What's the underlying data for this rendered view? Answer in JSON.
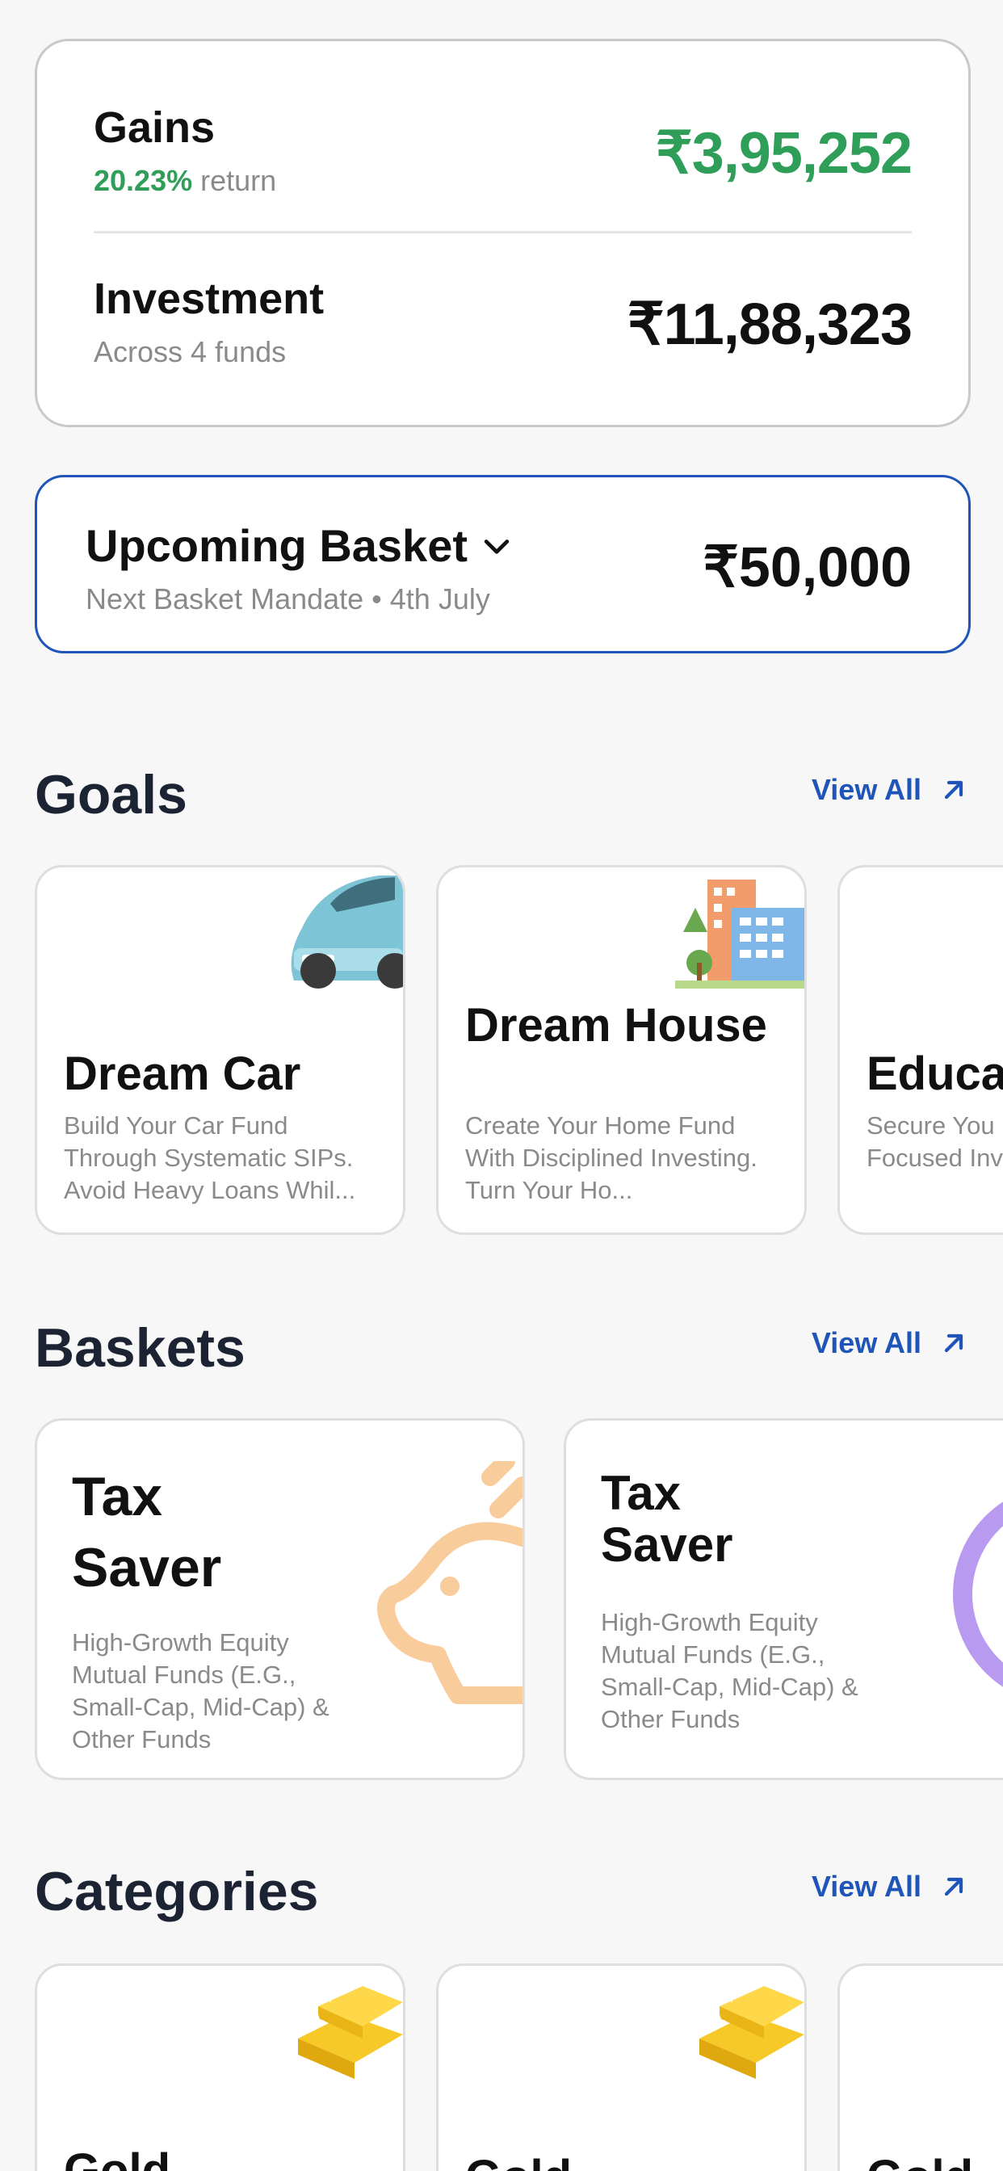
{
  "summary": {
    "gains_title": "Gains",
    "gains_pct": "20.23%",
    "gains_suffix": " return",
    "gains_amount": "₹3,95,252",
    "investment_title": "Investment",
    "investment_sub": "Across 4 funds",
    "investment_amount": "₹11,88,323"
  },
  "upcoming": {
    "title": "Upcoming Basket",
    "sub": "Next Basket Mandate • 4th July",
    "amount": "₹50,000"
  },
  "goals": {
    "title": "Goals",
    "view_all": "View All",
    "items": [
      {
        "title": "Dream Car",
        "desc": "Build Your Car Fund Through Systematic SIPs. Avoid Heavy Loans Whil..."
      },
      {
        "title": "Dream House",
        "desc": "Create Your Home Fund With Disciplined Investing. Turn Your  Ho..."
      },
      {
        "title": "Educa",
        "desc": "Secure You Future With Focused Inv"
      }
    ]
  },
  "baskets": {
    "title": "Baskets",
    "view_all": "View All",
    "items": [
      {
        "title": "Tax Saver",
        "desc": "High-Growth Equity Mutual Funds (E.G., Small-Cap, Mid-Cap) & Other Funds"
      },
      {
        "title": "Tax Saver",
        "desc": "High-Growth Equity Mutual Funds (E.G., Small-Cap, Mid-Cap) & Other Funds"
      }
    ]
  },
  "categories": {
    "title": "Categories",
    "view_all": "View All",
    "items": [
      {
        "title": "Gold"
      },
      {
        "title": "Gold"
      },
      {
        "title": "Gold"
      }
    ]
  },
  "colors": {
    "gain_green": "#2f9e58",
    "link_blue": "#1f55b8",
    "heading_navy": "#1c2333"
  },
  "icons": [
    "chevron-down-icon",
    "arrow-up-right-icon",
    "car-illustration",
    "building-illustration",
    "piggy-bank-illustration",
    "coin-illustration",
    "gold-bars-illustration"
  ]
}
